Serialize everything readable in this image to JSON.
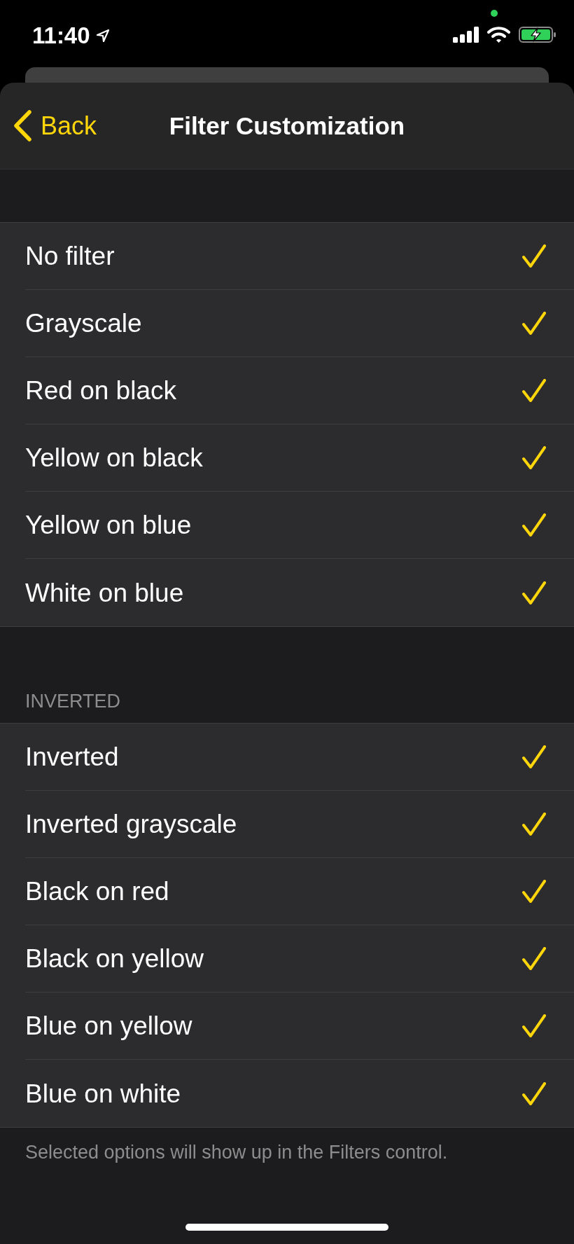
{
  "status_bar": {
    "time": "11:40"
  },
  "nav": {
    "back": "Back",
    "title": "Filter Customization"
  },
  "sections": [
    {
      "items": [
        {
          "label": "No filter",
          "checked": true
        },
        {
          "label": "Grayscale",
          "checked": true
        },
        {
          "label": "Red on black",
          "checked": true
        },
        {
          "label": "Yellow on black",
          "checked": true
        },
        {
          "label": "Yellow on blue",
          "checked": true
        },
        {
          "label": "White on blue",
          "checked": true
        }
      ]
    },
    {
      "header": "INVERTED",
      "items": [
        {
          "label": "Inverted",
          "checked": true
        },
        {
          "label": "Inverted grayscale",
          "checked": true
        },
        {
          "label": "Black on red",
          "checked": true
        },
        {
          "label": "Black on yellow",
          "checked": true
        },
        {
          "label": "Blue on yellow",
          "checked": true
        },
        {
          "label": "Blue on white",
          "checked": true
        }
      ],
      "footer": "Selected options will show up in the Filters control."
    }
  ]
}
